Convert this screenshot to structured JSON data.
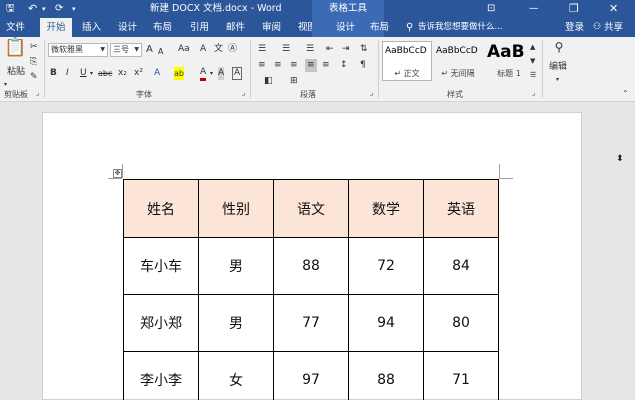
{
  "window": {
    "title": "新建 DOCX 文档.docx - Word",
    "context_tools": "表格工具",
    "icons": [
      "save-icon",
      "undo-icon",
      "redo-icon",
      "customize-qat-icon",
      "ribbon-display-icon",
      "minimize-icon",
      "restore-icon",
      "close-icon"
    ]
  },
  "tabs": [
    {
      "label": "文件"
    },
    {
      "label": "开始",
      "active": true
    },
    {
      "label": "插入"
    },
    {
      "label": "设计"
    },
    {
      "label": "布局"
    },
    {
      "label": "引用"
    },
    {
      "label": "邮件"
    },
    {
      "label": "审阅"
    },
    {
      "label": "视图"
    },
    {
      "label": "设计"
    },
    {
      "label": "布局"
    }
  ],
  "tell_me": "告诉我您想要做什么...",
  "login": "登录",
  "share": "共享",
  "ribbon": {
    "clipboard": {
      "label": "剪贴板",
      "paste": "粘贴"
    },
    "font": {
      "label": "字体",
      "font_name": "微软雅黑",
      "font_size": "三号",
      "bold": "B",
      "italic": "I",
      "underline": "U",
      "strikethrough": "abc",
      "subscript": "x₂",
      "superscript": "x²",
      "grow": "A",
      "shrink": "A",
      "aa": "Aa",
      "clear": "A",
      "wen": "文",
      "effects": "A",
      "highlight": "ab",
      "color": "A",
      "shade": "A",
      "border": "A",
      "accent_red": "#c00000",
      "accent_yellow": "#ffff00"
    },
    "paragraph": {
      "label": "段落"
    },
    "styles": {
      "label": "样式",
      "items": [
        {
          "sample": "AaBbCcD",
          "name": "↵ 正文"
        },
        {
          "sample": "AaBbCcD",
          "name": "↵ 无间隔"
        },
        {
          "sample": "AaB",
          "name": "标题 1"
        }
      ]
    },
    "editing": {
      "label": "编辑"
    }
  },
  "table": {
    "headers": [
      "姓名",
      "性别",
      "语文",
      "数学",
      "英语"
    ],
    "rows": [
      [
        "车小车",
        "男",
        "88",
        "72",
        "84"
      ],
      [
        "郑小郑",
        "男",
        "77",
        "94",
        "80"
      ],
      [
        "李小李",
        "女",
        "97",
        "88",
        "71"
      ]
    ],
    "header_fill": "#fce4d6"
  }
}
